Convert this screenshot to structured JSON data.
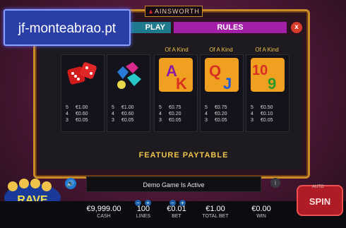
{
  "watermark": "jf-monteabrao.pt",
  "brand": "AINSWORTH",
  "tabs": {
    "play": "PLAY",
    "rules": "RULES"
  },
  "close_label": "x",
  "of_a_kind_label": "Of A Kind",
  "paytable": [
    {
      "symbol": "dice-icon",
      "rows": [
        [
          "5",
          "€1.00"
        ],
        [
          "4",
          "€0.60"
        ],
        [
          "3",
          "€0.05"
        ]
      ]
    },
    {
      "symbol": "gems-icon",
      "rows": [
        [
          "5",
          "€1.00"
        ],
        [
          "4",
          "€0.60"
        ],
        [
          "3",
          "€0.05"
        ]
      ]
    },
    {
      "symbol": "ace-king-icon",
      "rows": [
        [
          "5",
          "€0.75"
        ],
        [
          "4",
          "€0.20"
        ],
        [
          "3",
          "€0.05"
        ]
      ]
    },
    {
      "symbol": "queen-jack-icon",
      "rows": [
        [
          "5",
          "€0.75"
        ],
        [
          "4",
          "€0.20"
        ],
        [
          "3",
          "€0.05"
        ]
      ]
    },
    {
      "symbol": "ten-nine-icon",
      "rows": [
        [
          "5",
          "€0.50"
        ],
        [
          "4",
          "€0.10"
        ],
        [
          "3",
          "€0.05"
        ]
      ]
    }
  ],
  "feature_title": "FEATURE PAYTABLE",
  "status": "Demo Game Is Active",
  "bottom": {
    "cash": {
      "value": "€9,999.00",
      "label": "CASH"
    },
    "lines": {
      "value": "100",
      "label": "LINES"
    },
    "bet": {
      "value": "€0.01",
      "label": "BET"
    },
    "total_bet": {
      "value": "€1.00",
      "label": "TOTAL BET"
    },
    "win": {
      "value": "€0.00",
      "label": "WIN"
    }
  },
  "spin_label": "SPIN",
  "auto_label": "AUTO",
  "game_logo_text": "CASH RAVE"
}
